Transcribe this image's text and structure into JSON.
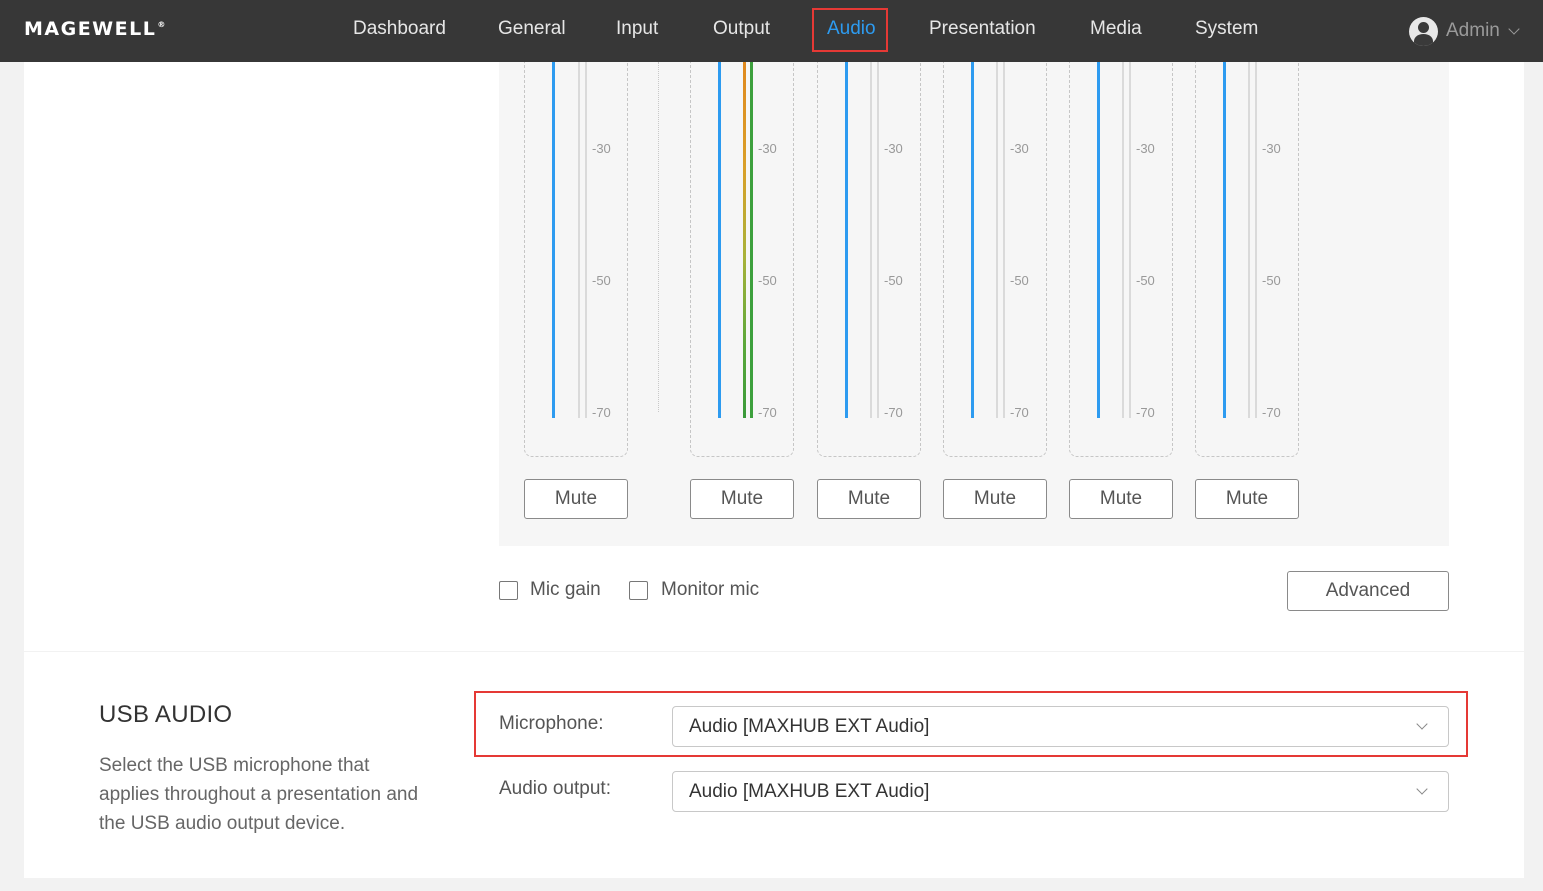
{
  "header": {
    "logo": "MAGEWELL",
    "logo_mark": "®",
    "nav": [
      {
        "label": "Dashboard"
      },
      {
        "label": "General"
      },
      {
        "label": "Input"
      },
      {
        "label": "Output"
      },
      {
        "label": "Audio",
        "active": true
      },
      {
        "label": "Presentation"
      },
      {
        "label": "Media"
      },
      {
        "label": "System"
      }
    ],
    "user": "Admin"
  },
  "mixer": {
    "channels": [
      {
        "ticks": [
          "-30",
          "-50",
          "-70"
        ],
        "mute_label": "Mute"
      },
      {
        "ticks": [
          "-30",
          "-50",
          "-70"
        ],
        "mute_label": "Mute"
      },
      {
        "ticks": [
          "-30",
          "-50",
          "-70"
        ],
        "mute_label": "Mute"
      },
      {
        "ticks": [
          "-30",
          "-50",
          "-70"
        ],
        "mute_label": "Mute"
      },
      {
        "ticks": [
          "-30",
          "-50",
          "-70"
        ],
        "mute_label": "Mute"
      },
      {
        "ticks": [
          "-30",
          "-50",
          "-70"
        ],
        "mute_label": "Mute"
      }
    ],
    "options": {
      "mic_gain": "Mic gain",
      "monitor_mic": "Monitor mic",
      "advanced": "Advanced"
    }
  },
  "usb_audio": {
    "title": "USB AUDIO",
    "description": "Select the USB microphone that applies throughout a presentation and the USB audio output device.",
    "microphone": {
      "label": "Microphone:",
      "value": "Audio [MAXHUB EXT Audio]"
    },
    "audio_output": {
      "label": "Audio output:",
      "value": "Audio [MAXHUB EXT Audio]"
    }
  },
  "colors": {
    "accent": "#2d9bf0",
    "highlight": "#e53935",
    "topbar": "#373737"
  }
}
